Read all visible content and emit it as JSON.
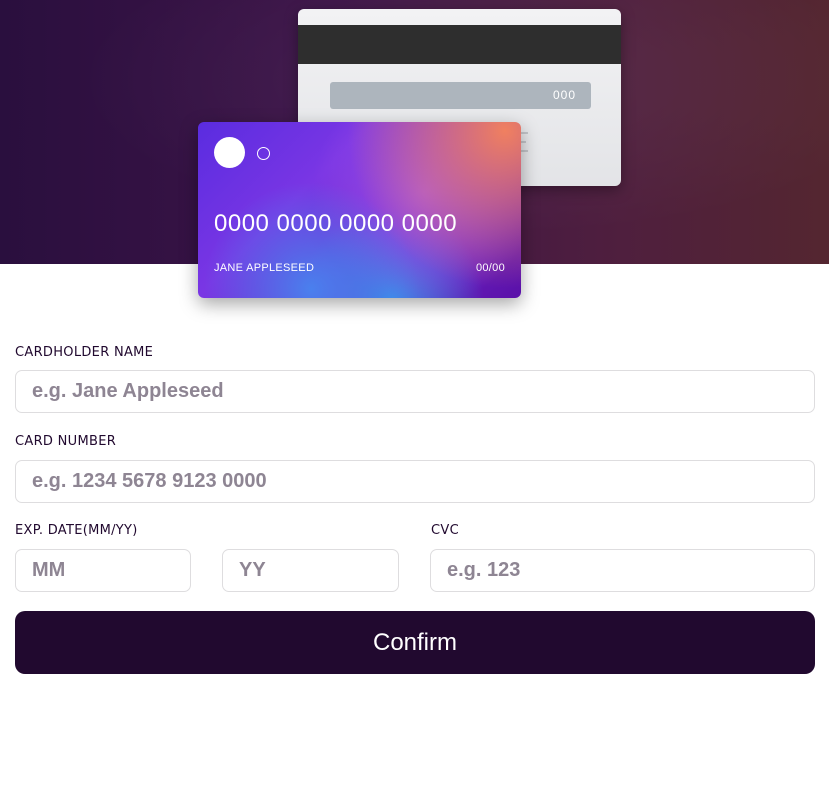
{
  "card_preview": {
    "back": {
      "cvc": "000"
    },
    "front": {
      "number": "0000 0000 0000 0000",
      "name": "JANE APPLESEED",
      "expiry": "00/00"
    }
  },
  "form": {
    "cardholder_name": {
      "label": "CARDHOLDER NAME",
      "placeholder": "e.g. Jane Appleseed",
      "value": ""
    },
    "card_number": {
      "label": "CARD NUMBER",
      "placeholder": "e.g. 1234 5678 9123 0000",
      "value": ""
    },
    "exp_date": {
      "label": "EXP. DATE(MM/YY)",
      "month_placeholder": "MM",
      "year_placeholder": "YY"
    },
    "cvc": {
      "label": "CVC",
      "placeholder": "e.g. 123",
      "value": ""
    },
    "confirm_label": "Confirm"
  },
  "colors": {
    "dark_violet": "#21092f",
    "input_border": "#dedddf",
    "placeholder": "#8e8593"
  }
}
